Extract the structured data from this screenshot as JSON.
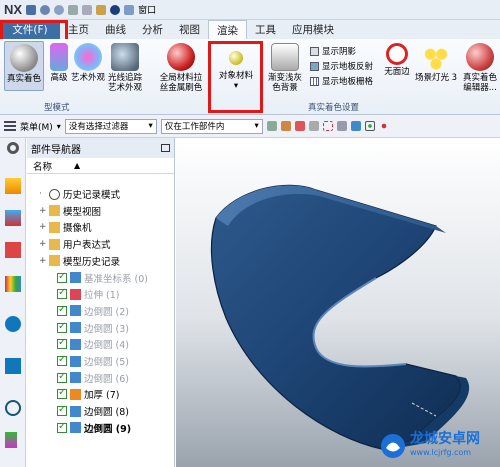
{
  "titlebar": {
    "app": "NX",
    "window_menu": "窗口"
  },
  "menu": {
    "file": "文件(F)",
    "tabs": [
      "主页",
      "曲线",
      "分析",
      "视图",
      "渲染",
      "工具",
      "应用模块"
    ]
  },
  "ribbon": {
    "buttons": {
      "true_shading": "真实着色",
      "hq": "高级",
      "art_appearance": "艺术外观",
      "raytrace": [
        "光线追踪",
        "艺术外观"
      ],
      "global_material": [
        "全局材料拉",
        "丝金属刷色"
      ],
      "object_material": "对象材料",
      "gradient_bg": [
        "渐变浅灰",
        "色背景"
      ],
      "no_edge": "无面边",
      "scene_light": "场景灯光 3",
      "shading_editor": [
        "真实着色",
        "编辑器..."
      ]
    },
    "small_buttons": [
      "显示阴影",
      "显示地板反射",
      "显示地板栅格"
    ],
    "group_labels": [
      "型模式",
      "真实着色设置"
    ]
  },
  "toolbar2": {
    "menu": "菜单(M)",
    "filter": "没有选择过滤器",
    "scope": "仅在工作部件内"
  },
  "navigator": {
    "title": "部件导航器",
    "col_name": "名称",
    "rows": [
      {
        "label": "历史记录模式",
        "indent": 0,
        "style": "normal"
      },
      {
        "label": "模型视图",
        "indent": 0,
        "style": "normal"
      },
      {
        "label": "摄像机",
        "indent": 0,
        "style": "normal"
      },
      {
        "label": "用户表达式",
        "indent": 0,
        "style": "normal"
      },
      {
        "label": "模型历史记录",
        "indent": 0,
        "style": "normal"
      },
      {
        "label": "基准坐标系 (0)",
        "indent": 1,
        "style": "gray"
      },
      {
        "label": "拉伸 (1)",
        "indent": 1,
        "style": "gray"
      },
      {
        "label": "边倒圆 (2)",
        "indent": 1,
        "style": "gray"
      },
      {
        "label": "边倒圆 (3)",
        "indent": 1,
        "style": "gray"
      },
      {
        "label": "边倒圆 (4)",
        "indent": 1,
        "style": "gray"
      },
      {
        "label": "边倒圆 (5)",
        "indent": 1,
        "style": "gray"
      },
      {
        "label": "边倒圆 (6)",
        "indent": 1,
        "style": "gray"
      },
      {
        "label": "加厚 (7)",
        "indent": 1,
        "style": "normal"
      },
      {
        "label": "边倒圆 (8)",
        "indent": 1,
        "style": "normal"
      },
      {
        "label": "边倒圆 (9)",
        "indent": 1,
        "style": "bold"
      }
    ]
  },
  "watermark": {
    "name": "龙城安卓网",
    "url": "www.lcjrfg.com"
  }
}
